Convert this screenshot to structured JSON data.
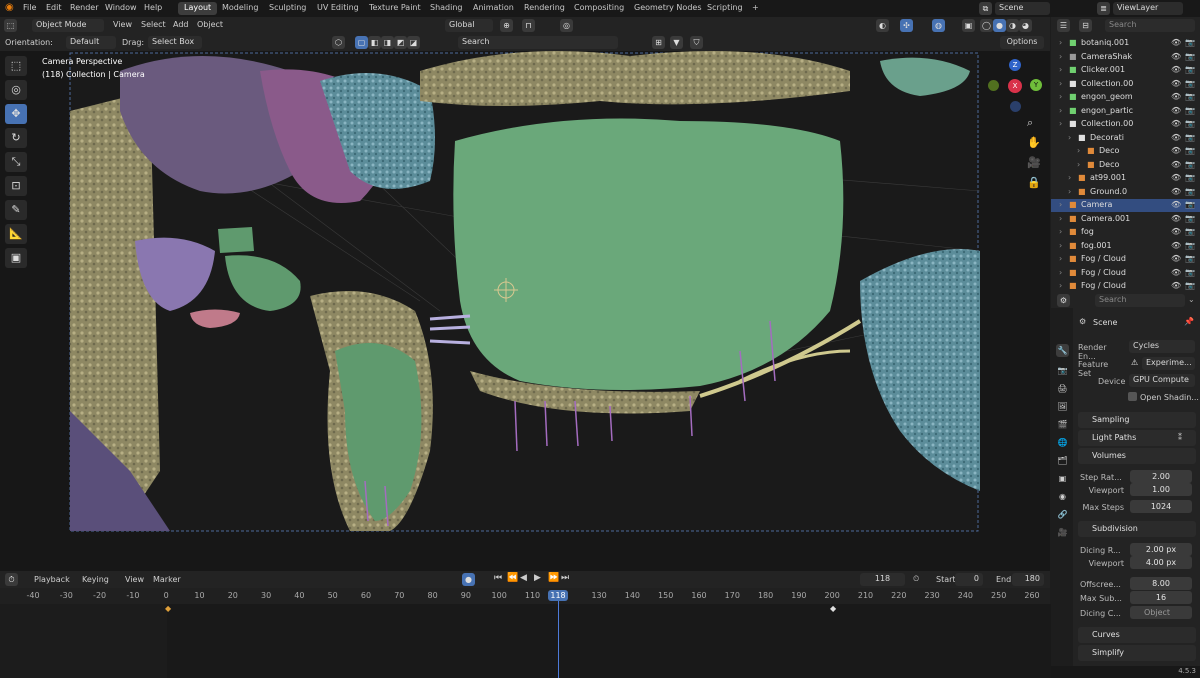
{
  "topbar": {
    "menus": [
      "File",
      "Edit",
      "Render",
      "Window",
      "Help"
    ],
    "workspaces": [
      "Layout",
      "Modeling",
      "Sculpting",
      "UV Editing",
      "Texture Paint",
      "Shading",
      "Animation",
      "Rendering",
      "Compositing",
      "Geometry Nodes",
      "Scripting"
    ],
    "active_workspace": "Layout",
    "add_tab": "+",
    "scene": "Scene",
    "view_layer": "ViewLayer"
  },
  "header": {
    "mode": "Object Mode",
    "menus": [
      "View",
      "Select",
      "Add",
      "Object"
    ],
    "transform_orientation": "Global",
    "orientation_label": "Orientation:",
    "orientation_value": "Default",
    "drag_label": "Drag:",
    "drag_value": "Select Box",
    "search_placeholder": "Search",
    "options": "Options"
  },
  "viewport": {
    "view_name": "Camera Perspective",
    "collection_info": "(118) Collection | Camera",
    "gizmo": {
      "z": "Z",
      "y": "Y",
      "x": "X"
    }
  },
  "timeline": {
    "menus": [
      "Playback",
      "Keying",
      "View",
      "Marker"
    ],
    "current_frame": "118",
    "start_label": "Start",
    "start": "0",
    "end_label": "End",
    "end": "180",
    "ruler": [
      "-40",
      "-30",
      "-20",
      "-10",
      "0",
      "10",
      "20",
      "30",
      "40",
      "50",
      "60",
      "70",
      "80",
      "90",
      "100",
      "110",
      "118",
      "130",
      "140",
      "150",
      "160",
      "170",
      "180",
      "190",
      "200",
      "210",
      "220",
      "230",
      "240",
      "250",
      "260"
    ]
  },
  "outliner": {
    "search_placeholder": "Search",
    "rows": [
      {
        "name": "botaniq.001",
        "indent": 2,
        "selected": false
      },
      {
        "name": "CameraShak",
        "indent": 2,
        "selected": false
      },
      {
        "name": "Clicker.001",
        "indent": 2,
        "selected": false
      },
      {
        "name": "Collection.00",
        "indent": 2,
        "selected": false
      },
      {
        "name": "engon_geom",
        "indent": 2,
        "selected": false
      },
      {
        "name": "engon_partic",
        "indent": 2,
        "selected": false
      },
      {
        "name": "Collection.00",
        "indent": 2,
        "selected": false
      },
      {
        "name": "Decorati",
        "indent": 3,
        "selected": false
      },
      {
        "name": "Deco",
        "indent": 4,
        "selected": false
      },
      {
        "name": "Deco",
        "indent": 4,
        "selected": false
      },
      {
        "name": "at99.001",
        "indent": 3,
        "selected": false
      },
      {
        "name": "Ground.0",
        "indent": 3,
        "selected": false
      },
      {
        "name": "Camera",
        "indent": 2,
        "selected": true
      },
      {
        "name": "Camera.001",
        "indent": 2,
        "selected": false
      },
      {
        "name": "fog",
        "indent": 2,
        "selected": false
      },
      {
        "name": "fog.001",
        "indent": 2,
        "selected": false
      },
      {
        "name": "Fog / Cloud",
        "indent": 2,
        "selected": false
      },
      {
        "name": "Fog / Cloud",
        "indent": 2,
        "selected": false
      },
      {
        "name": "Fog / Cloud",
        "indent": 2,
        "selected": false
      }
    ]
  },
  "properties": {
    "search_placeholder": "Search",
    "scene": "Scene",
    "render_engine_label": "Render En...",
    "render_engine": "Cycles",
    "feature_set_label": "Feature Set",
    "feature_set": "Experime...",
    "device_label": "Device",
    "device": "GPU Compute",
    "open_shading": "Open Shadin...",
    "sampling": "Sampling",
    "light_paths": "Light Paths",
    "volumes": "Volumes",
    "step_rate_label": "Step Rat...",
    "step_rate": "2.00",
    "viewport_label": "Viewport",
    "viewport_value": "1.00",
    "max_steps_label": "Max Steps",
    "max_steps": "1024",
    "subdivision": "Subdivision",
    "dicing_rate_label": "Dicing R...",
    "dicing_rate": "2.00 px",
    "sub_viewport_label": "Viewport",
    "sub_viewport": "4.00 px",
    "offscreen_label": "Offscree...",
    "offscreen": "8.00",
    "max_sub_label": "Max Sub...",
    "max_sub": "16",
    "dicing_camera_label": "Dicing C...",
    "dicing_camera": "Object",
    "curves": "Curves",
    "simplify": "Simplify",
    "version": "4.5.3"
  }
}
